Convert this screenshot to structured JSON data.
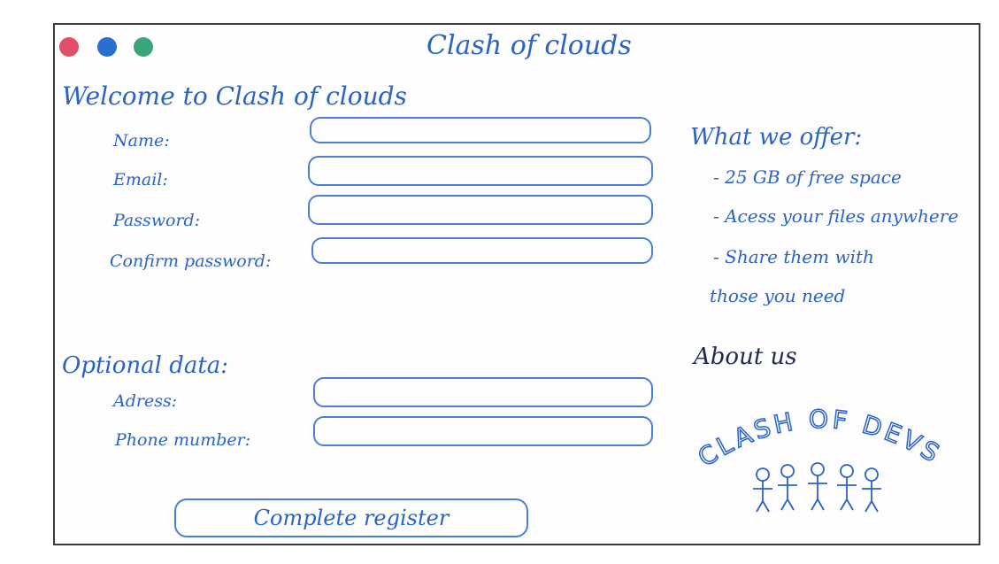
{
  "window": {
    "title": "Clash of clouds"
  },
  "header": {
    "welcome": "Welcome to Clash of clouds"
  },
  "form": {
    "name_label": "Name:",
    "email_label": "Email:",
    "password_label": "Password:",
    "confirm_label": "Confirm password:",
    "optional_title": "Optional data:",
    "address_label": "Adress:",
    "phone_label": "Phone mumber:",
    "submit_label": "Complete register"
  },
  "offer": {
    "title": "What we offer:",
    "items": [
      "- 25 GB of free space",
      "- Acess your files anywhere",
      "- Share them with",
      "those you need"
    ]
  },
  "about": {
    "title": "About us",
    "logo_text": "CLASH OF DEVS"
  },
  "colors": {
    "ink": "#2a63c4",
    "red_dot": "#e0506a",
    "blue_dot": "#2a6fd0",
    "green_dot": "#3aa57a"
  }
}
